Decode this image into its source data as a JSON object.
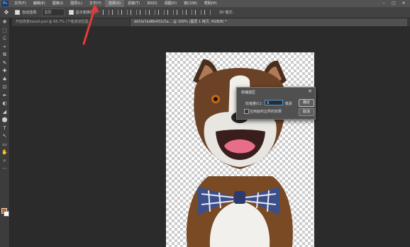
{
  "menubar": {
    "logo": "Ps",
    "items": [
      "文件(F)",
      "编辑(E)",
      "图像(I)",
      "图层(L)",
      "文字(Y)",
      "选择(S)",
      "滤镜(T)",
      "3D(D)",
      "视图(V)",
      "窗口(W)",
      "帮助(H)"
    ],
    "active_index": 5,
    "window_controls": [
      "–",
      "▢",
      "✕"
    ]
  },
  "options": {
    "auto_select_label": "自动选择:",
    "auto_select_value": "图层",
    "show_transform_label": "显示变换控件",
    "mode_3d": "3D 模式:"
  },
  "tabs": {
    "inactive": "开始修复kaisel.psd @ 66.7% (下载通道抠图...",
    "active": "dd1fa7ad8b432c5a... @ 100% (图层 1 拷贝, RGB/8) *"
  },
  "toolbar": {
    "tools": [
      "✥",
      "⬚",
      "ℒ",
      "⌖",
      "⧉",
      "✎",
      "✚",
      "♣",
      "⊡",
      "✒",
      "◐",
      "◢",
      "⬤",
      "T",
      "↖",
      "▭",
      "✋",
      "⌕",
      "⋯"
    ]
  },
  "colors": {
    "foreground": "#c8641e",
    "background": "#ffffff",
    "accent": "#4a9be0",
    "annotation_arrow": "#e23b3b"
  },
  "dialog": {
    "title": "收缩选区",
    "close": "✕",
    "contract_label": "收缩量(C):",
    "contract_value": "3",
    "unit": "像素",
    "apply_canvas_label": "应用画布边界的效果",
    "ok_label": "确定",
    "cancel_label": "取消"
  }
}
